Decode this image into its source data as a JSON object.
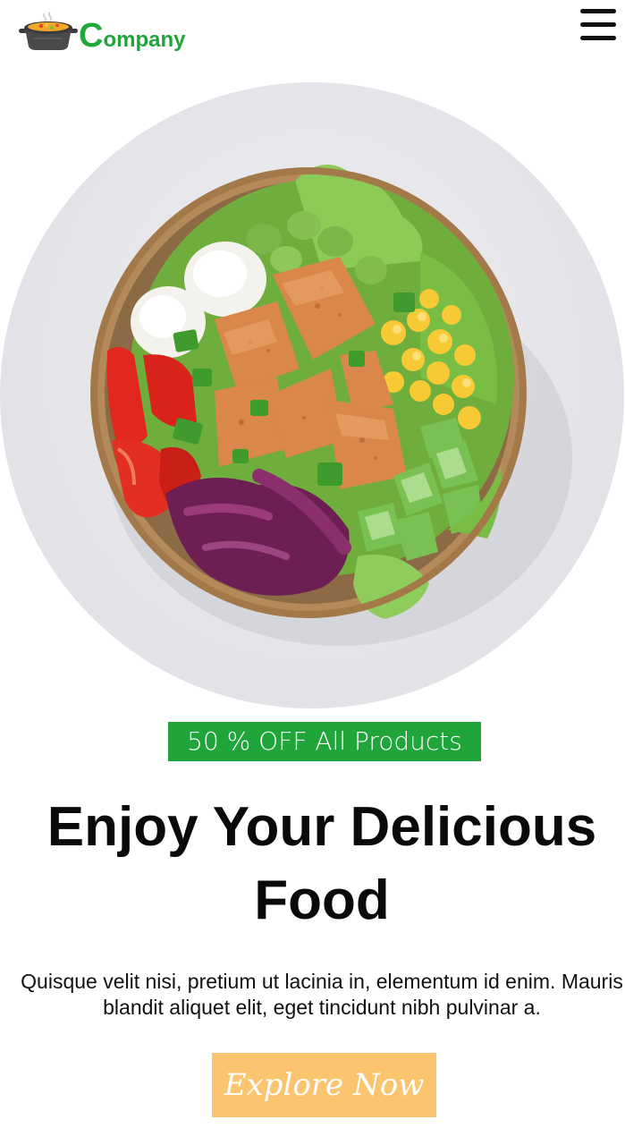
{
  "header": {
    "logo_text": "ompany",
    "logo_initial": "C",
    "logo_icon": "cooking-pot-icon",
    "menu_icon": "hamburger-menu-icon"
  },
  "hero": {
    "image_alt": "Bowl of salad with tofu, eggs, corn, cucumber and vegetables",
    "badge_text": "50 % OFF All Products",
    "headline": "Enjoy Your Delicious Food",
    "description": "Quisque velit nisi, pretium ut lacinia in, elementum id enim. Mauris blandit aliquet elit, eget tincidunt nibh pulvinar a.",
    "cta_label": "Explore Now"
  },
  "colors": {
    "brand_green": "#1fa53a",
    "cta_orange": "#fbc46e",
    "text_dark": "#0a0a0a",
    "background": "#ffffff"
  }
}
